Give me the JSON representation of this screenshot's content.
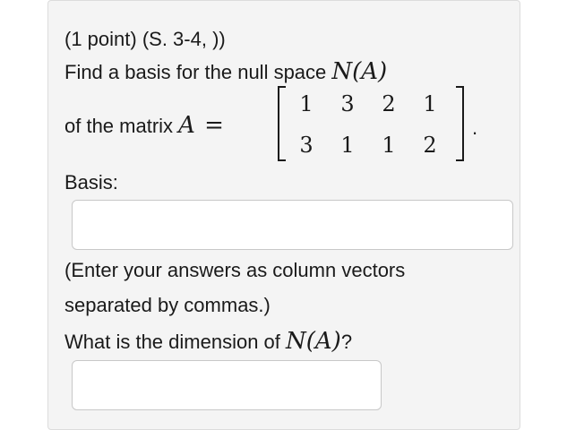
{
  "problem": {
    "header": "(1 point) (S. 3-4, ))",
    "prompt_prefix": "Find a basis for the null space ",
    "null_space_symbol": "N(A)",
    "matrix_label_prefix": "of the matrix ",
    "matrix_symbol": "A",
    "equals": "=",
    "matrix_rows": [
      [
        "1",
        "3",
        "2",
        "1"
      ],
      [
        "3",
        "1",
        "1",
        "2"
      ]
    ],
    "trailing_period": ".",
    "basis_label": "Basis:",
    "basis_value": "",
    "instruction_line1": "(Enter your answers as column vectors",
    "instruction_line2": "separated by commas.)",
    "dimension_prefix": "What is the dimension of ",
    "dimension_symbol": "N(A)",
    "dimension_suffix": "?",
    "dimension_value": ""
  }
}
